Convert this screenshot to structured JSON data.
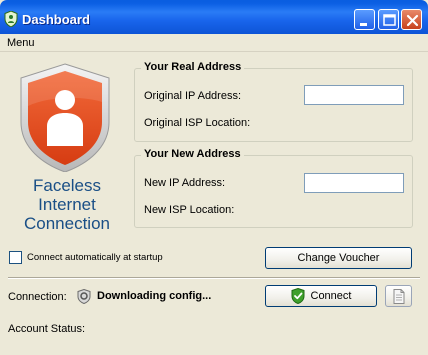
{
  "window": {
    "title": "Dashboard",
    "icon": "shield-app-icon",
    "controls": [
      "minimize",
      "maximize",
      "close"
    ]
  },
  "menu": {
    "items": [
      "Menu"
    ]
  },
  "brand": {
    "line1": "Faceless",
    "line2": "Internet",
    "line3": "Connection",
    "logo": "person-shield-icon",
    "color": "#1a4f86",
    "logo_color": "#e2461b"
  },
  "real_address": {
    "title": "Your Real Address",
    "ip_label": "Original IP Address:",
    "ip_value": "",
    "isp_label": "Original ISP Location:",
    "isp_value": ""
  },
  "new_address": {
    "title": "Your New Address",
    "ip_label": "New IP Address:",
    "ip_value": "",
    "isp_label": "New ISP Location:",
    "isp_value": ""
  },
  "startup": {
    "label": "Connect automatically at startup",
    "checked": false
  },
  "buttons": {
    "change_voucher": "Change Voucher",
    "connect": "Connect",
    "log": "document-icon"
  },
  "status": {
    "connection_label": "Connection:",
    "connection_value": "Downloading config...",
    "account_label": "Account Status:",
    "account_value": ""
  }
}
